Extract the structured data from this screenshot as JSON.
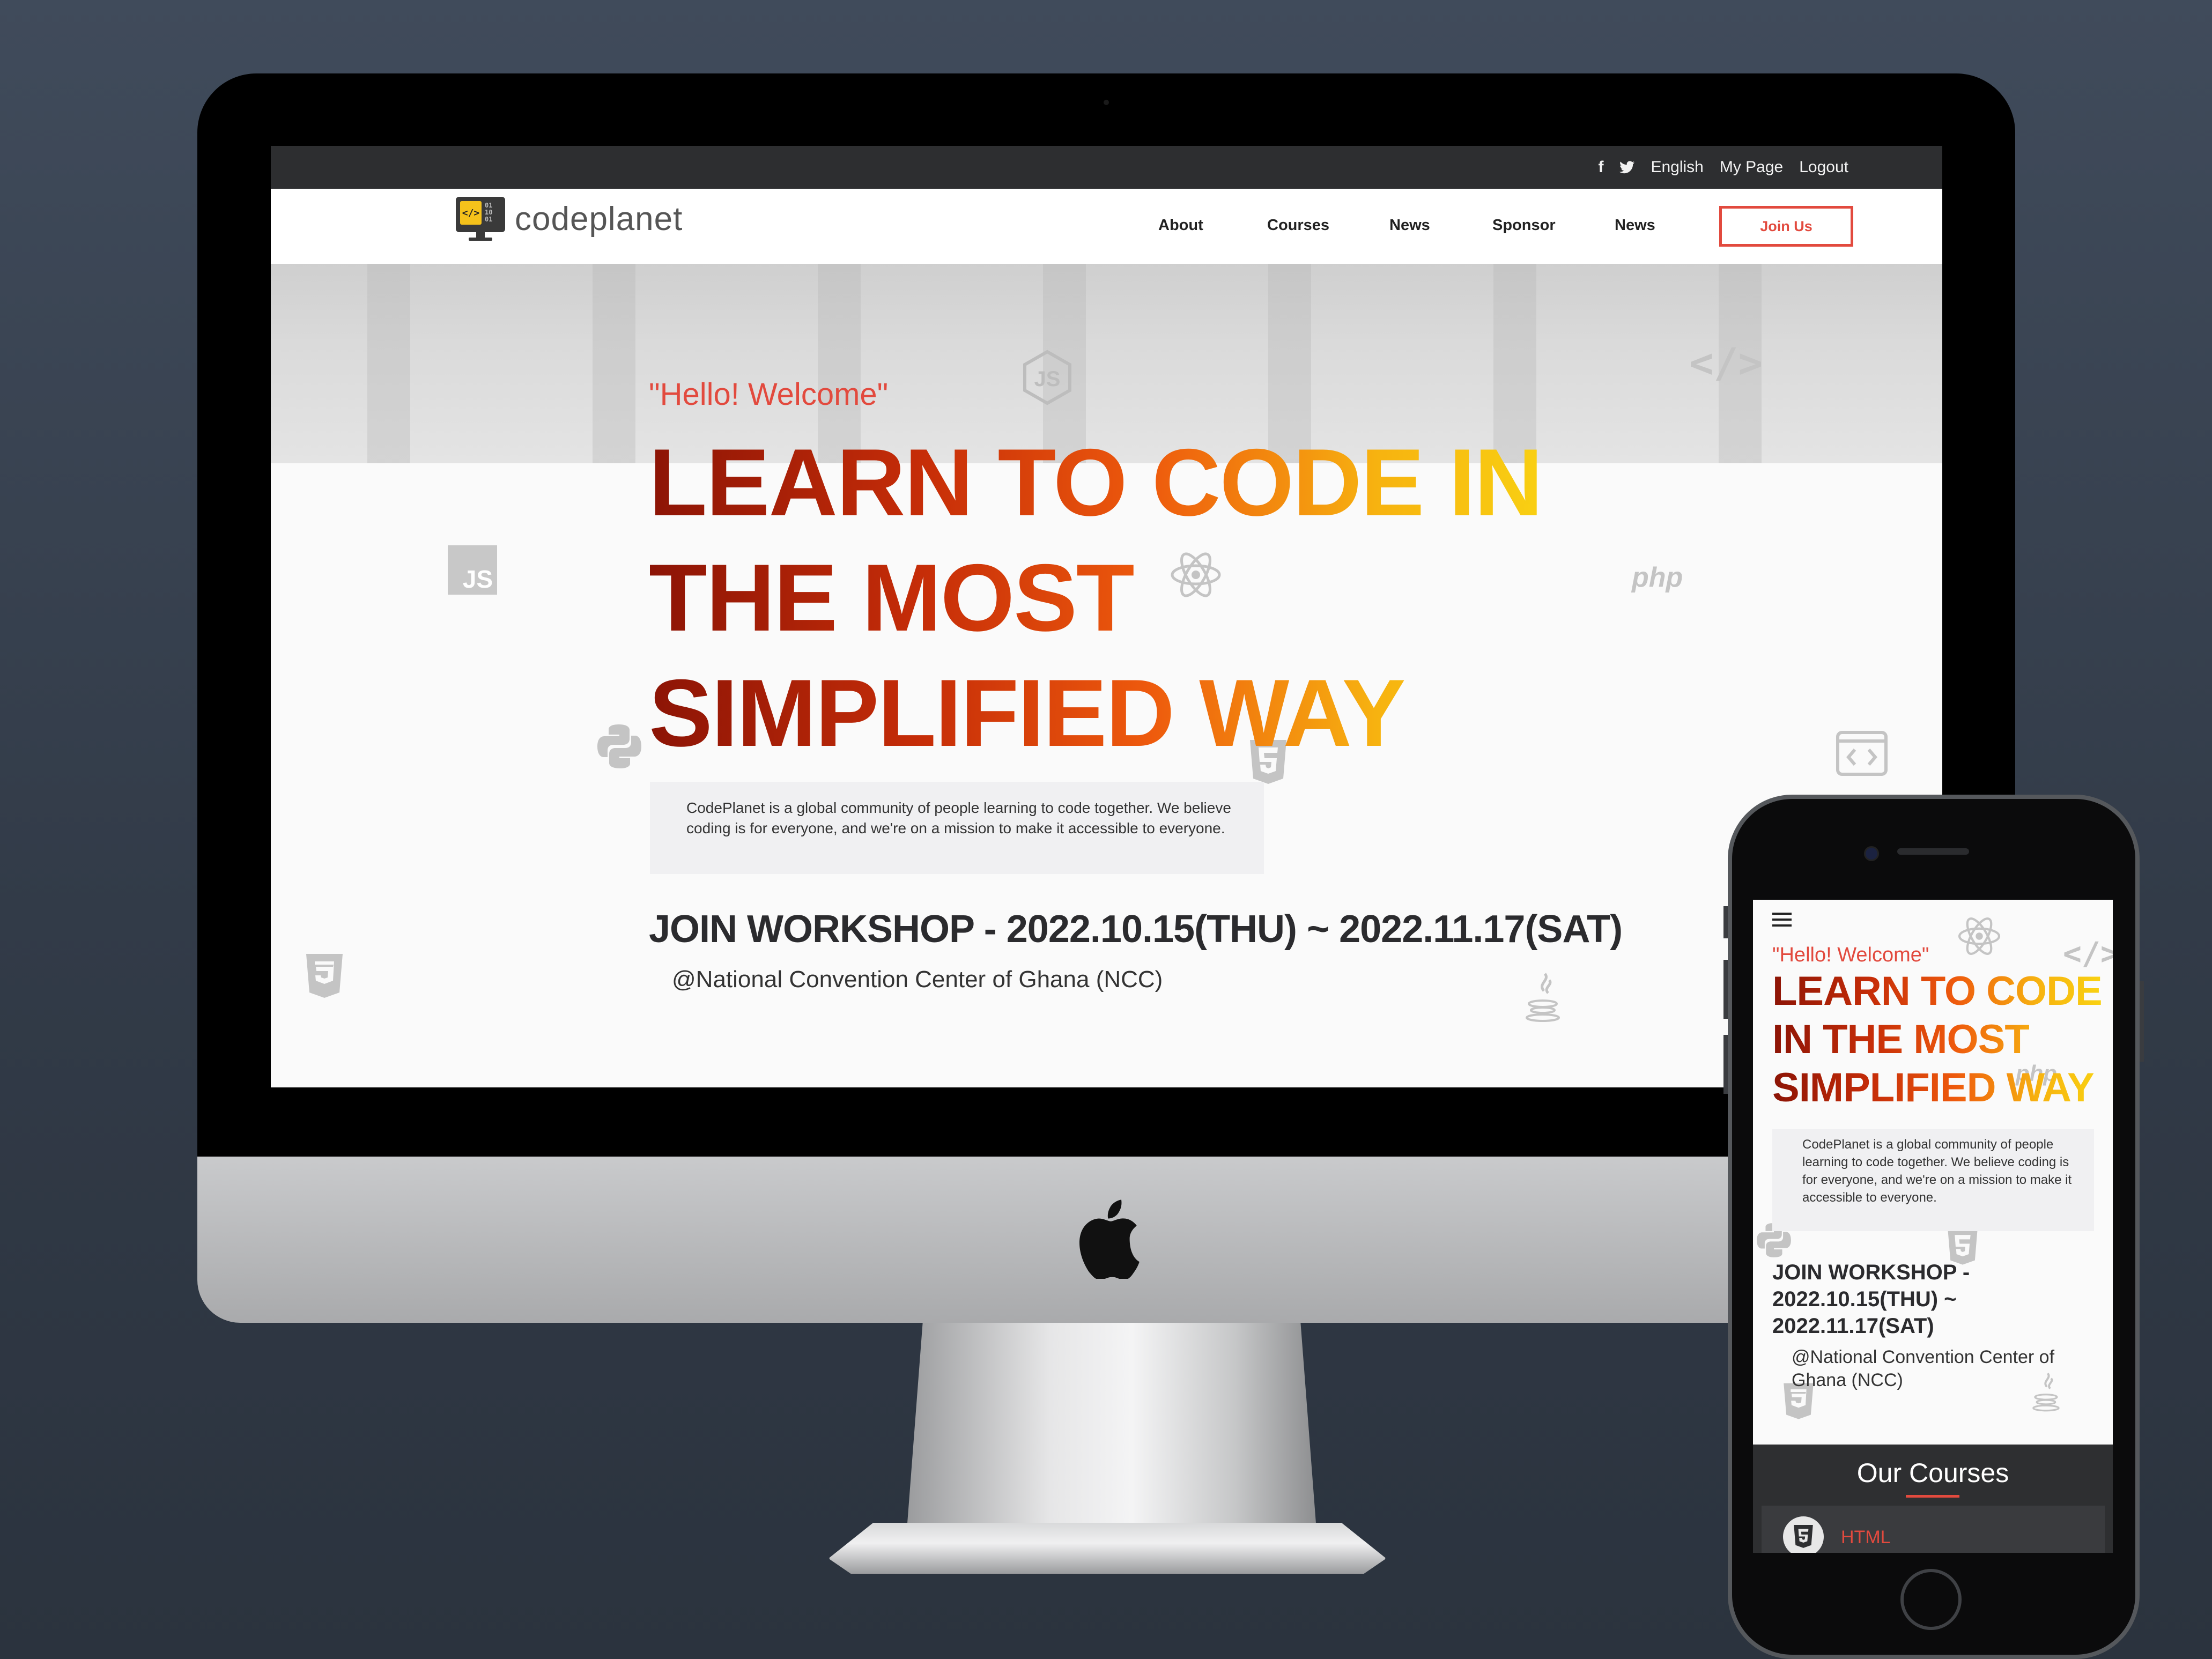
{
  "site": {
    "logo_text": "codeplanet",
    "topbar": {
      "facebook_icon": "f",
      "twitter_icon": "twitter",
      "language": "English",
      "my_page": "My Page",
      "logout": "Logout"
    },
    "nav": {
      "items": [
        "About",
        "Courses",
        "News",
        "Sponsor",
        "News"
      ],
      "join_label": "Join Us"
    },
    "hero": {
      "greeting": "\"Hello! Welcome\"",
      "headline": "LEARN TO CODE IN THE MOST SIMPLIFIED WAY",
      "description": "CodePlanet is a global community of people learning to code together. We believe coding is for everyone, and we're on a mission to make it accessible to everyone.",
      "workshop": "JOIN WORKSHOP - 2022.10.15(THU) ~ 2022.11.17(SAT)",
      "venue": "@National Convention Center of Ghana (NCC)"
    },
    "ghost_icons": [
      "JS",
      "php",
      "</>",
      "node-js",
      "react",
      "python",
      "html5",
      "css3",
      "java",
      "code-window"
    ]
  },
  "mobile": {
    "menu_icon": "hamburger",
    "greeting": "\"Hello! Welcome\"",
    "headline_lines": [
      "LEARN TO CODE",
      "IN THE MOST",
      "SIMPLIFIED WAY"
    ],
    "description": "CodePlanet is a global community of people learning to code together. We believe coding is for everyone, and we're on a mission to make it accessible to everyone.",
    "workshop": "JOIN WORKSHOP - 2022.10.15(THU) ~ 2022.11.17(SAT)",
    "venue": "@National Convention Center of Ghana (NCC)",
    "courses_title": "Our Courses",
    "courses": [
      {
        "label": "HTML",
        "icon": "html5"
      }
    ]
  },
  "colors": {
    "accent": "#e24a3e",
    "gradient": [
      "#8c1406",
      "#ee5a0d",
      "#f9d312"
    ],
    "topbar": "#2d2e30",
    "background": "#3b4554"
  }
}
